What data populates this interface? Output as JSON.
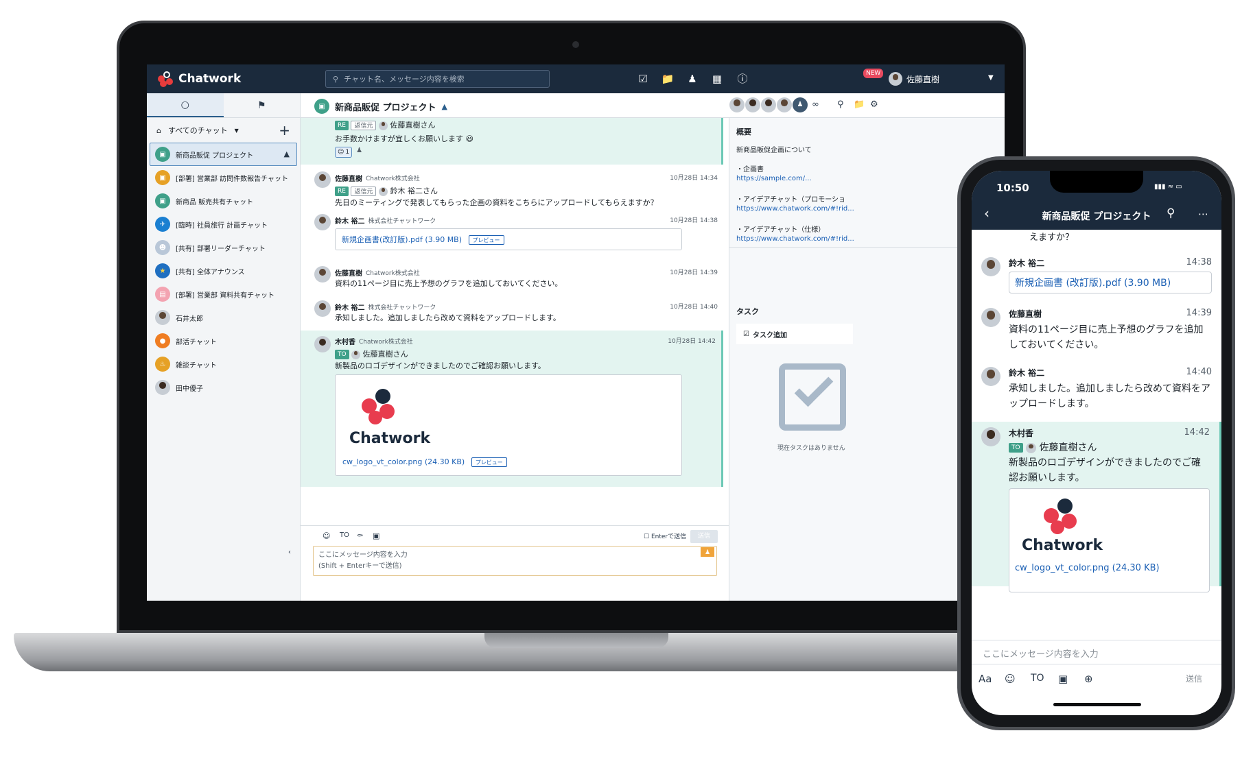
{
  "app": {
    "name": "Chatwork",
    "search_placeholder": "チャット名、メッセージ内容を検索",
    "new_badge": "NEW",
    "user_name": "佐藤直樹"
  },
  "sidebar": {
    "filter_label": "すべてのチャット",
    "rooms": [
      {
        "name": "新商品販促 プロジェクト",
        "color": "#3fa089",
        "active": true
      },
      {
        "name": "[部署] 営業部 訪問件数報告チャット",
        "color": "#e6a126"
      },
      {
        "name": "新商品 販売共有チャット",
        "color": "#3fa089"
      },
      {
        "name": "[臨時] 社員旅行 計画チャット",
        "color": "#1a7fd1"
      },
      {
        "name": "[共有] 部署リーダーチャット",
        "color": "#b9c7d8"
      },
      {
        "name": "[共有] 全体アナウンス",
        "color": "#1f6fc1"
      },
      {
        "name": "[部署] 営業部 資料共有チャット",
        "color": "#f3a3b1"
      },
      {
        "name": "石井太郎",
        "color": "#c7cdd4"
      },
      {
        "name": "部活チャット",
        "color": "#ef7d22"
      },
      {
        "name": "雑談チャット",
        "color": "#e6a126"
      },
      {
        "name": "田中優子",
        "color": "#c7cdd4"
      }
    ]
  },
  "chat": {
    "title": "新商品販促 プロジェクト",
    "messages": [
      {
        "re_tag": "RE",
        "src_tag": "返信元",
        "mention": "佐藤直樹さん",
        "body": "お手数かけますが宜しくお願いします",
        "reaction_count": "1"
      },
      {
        "name": "佐藤直樹",
        "org": "Chatwork株式会社",
        "time": "10月28日 14:34",
        "re_tag": "RE",
        "src_tag": "返信元",
        "mention": "鈴木 裕二さん",
        "body": "先日のミーティングで発表してもらった企画の資料をこちらにアップロードしてもらえますか？"
      },
      {
        "name": "鈴木 裕二",
        "org": "株式会社チャットワーク",
        "time": "10月28日 14:38",
        "file": "新規企画書(改訂版).pdf (3.90 MB)",
        "preview": "プレビュー"
      },
      {
        "name": "佐藤直樹",
        "org": "Chatwork株式会社",
        "time": "10月28日 14:39",
        "body": "資料の11ページ目に売上予想のグラフを追加しておいてください。"
      },
      {
        "name": "鈴木 裕二",
        "org": "株式会社チャットワーク",
        "time": "10月28日 14:40",
        "body": "承知しました。追加しましたら改めて資料をアップロードします。"
      },
      {
        "name": "木村香",
        "org": "Chatwork株式会社",
        "time": "10月28日 14:42",
        "to_tag": "TO",
        "mention": "佐藤直樹さん",
        "body": "新製品のロゴデザインができましたのでご確認お願いします。",
        "image_logo_text": "Chatwork",
        "file": "cw_logo_vt_color.png (24.30 KB)",
        "preview": "プレビュー"
      }
    ],
    "composer": {
      "to_label": "TO",
      "enter_to_send": "Enterで送信",
      "send_label": "送信",
      "placeholder_line1": "ここにメッセージ内容を入力",
      "placeholder_line2": "(Shift + Enterキーで送信)"
    }
  },
  "panel": {
    "overview_title": "概要",
    "overview_desc": "新商品販促企画について",
    "items": [
      {
        "label": "・企画書",
        "link": "https://sample.com/..."
      },
      {
        "label": "・アイデアチャット（プロモーショ",
        "link": "https://www.chatwork.com/#!rid..."
      },
      {
        "label": "・アイデアチャット（仕様）",
        "link": "https://www.chatwork.com/#!rid..."
      }
    ],
    "task_title": "タスク",
    "task_add": "タスク追加",
    "no_task": "現在タスクはありません"
  },
  "phone": {
    "time": "10:50",
    "title": "新商品販促 プロジェクト",
    "partial_text": "えますか？",
    "messages": [
      {
        "name": "鈴木 裕二",
        "time": "14:38",
        "file": "新規企画書 (改訂版).pdf (3.90 MB)"
      },
      {
        "name": "佐藤直樹",
        "time": "14:39",
        "body": "資料の11ページ目に売上予想のグラフを追加しておいてください。"
      },
      {
        "name": "鈴木 裕二",
        "time": "14:40",
        "body": "承知しました。追加しましたら改めて資料をアップロードします。"
      },
      {
        "name": "木村香",
        "time": "14:42",
        "to_tag": "TO",
        "mention": "佐藤直樹さん",
        "body": "新製品のロゴデザインができましたのでご確認お願いします。",
        "image_logo_text": "Chatwork",
        "file": "cw_logo_vt_color.png (24.30 KB)"
      }
    ],
    "input_placeholder": "ここにメッセージ内容を入力",
    "tool_aa": "Aa",
    "tool_to": "TO",
    "send_label": "送信"
  }
}
